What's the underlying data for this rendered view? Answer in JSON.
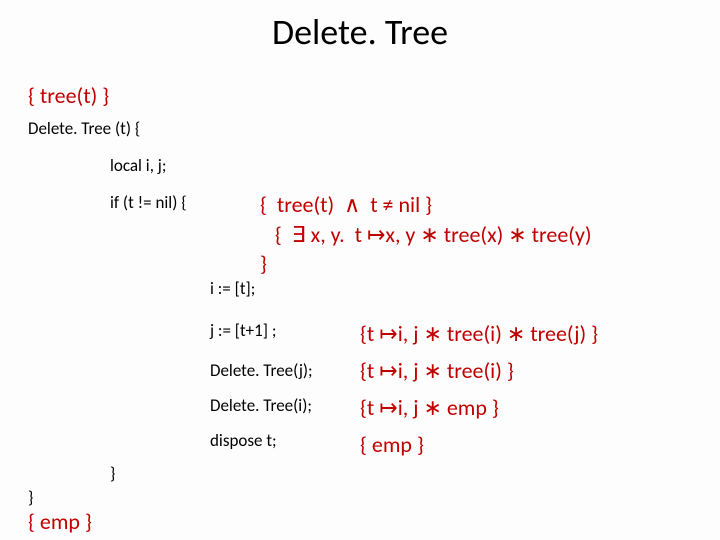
{
  "title": "Delete. Tree",
  "precondition": "{  tree(t)  }",
  "signature": "Delete. Tree (t) {",
  "locals": "local i, j;",
  "if_line": "if (t != nil)  {",
  "stmts": {
    "i_assign": "i := [t];",
    "j_assign": "j := [t+1] ;",
    "delete_j": "Delete. Tree(j);",
    "delete_i": "Delete. Tree(i);",
    "dispose": "dispose t;"
  },
  "close_inner": "}",
  "close_outer": "}",
  "postcondition": "{  emp  }",
  "asserts": {
    "block1": "{  tree(t)  ∧  t ≠ nil }\n   {  ∃ x, y.  t ↦x, y ∗ tree(x) ∗ tree(y)\n}",
    "a2": "{t ↦i, j ∗ tree(i) ∗ tree(j)  }",
    "a3": "{t ↦i, j ∗ tree(i) }",
    "a4": "{t ↦i, j ∗ emp }",
    "a5": "{  emp  }"
  }
}
